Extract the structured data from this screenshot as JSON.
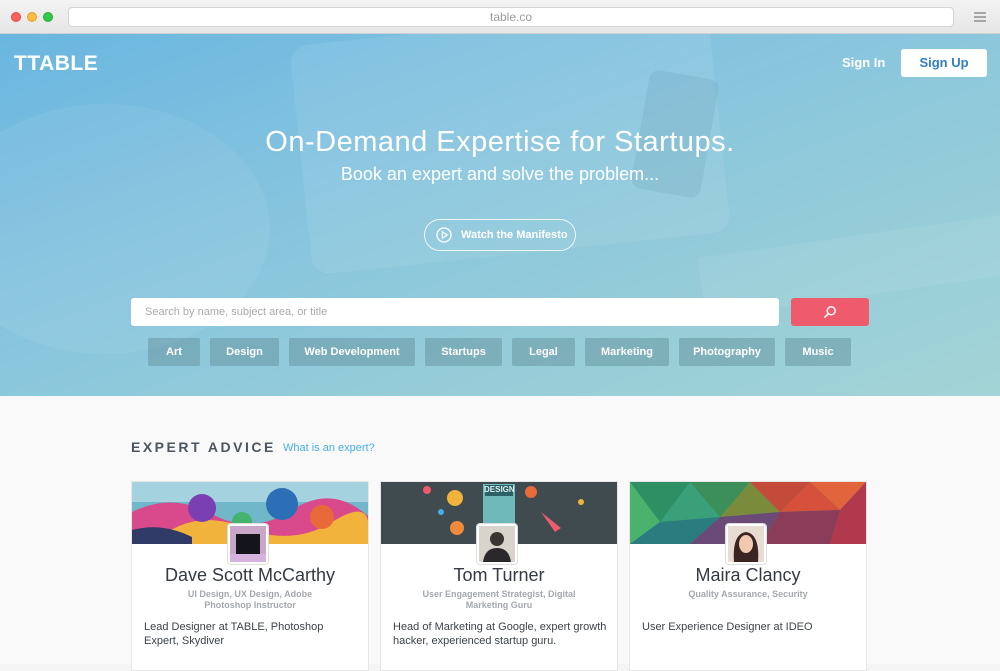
{
  "browser": {
    "url": "table.co",
    "menu_icon": "hamburger-icon"
  },
  "header": {
    "logo": "TTABLE",
    "signin": "Sign In",
    "signup": "Sign Up"
  },
  "hero": {
    "title": "On-Demand Expertise for Startups.",
    "subtitle": "Book an expert and solve the problem...",
    "manifesto_label": "Watch the Manifesto",
    "search_placeholder": "Search by name, subject area, or title",
    "tags": [
      "Art",
      "Design",
      "Web Development",
      "Startups",
      "Legal",
      "Marketing",
      "Photography",
      "Music"
    ]
  },
  "colors": {
    "accent": "#ef5b6d",
    "link": "#4aaee5",
    "signup_text": "#2f7fc1"
  },
  "expert_section": {
    "title": "EXPERT ADVICE",
    "link": "What is an expert?",
    "cards": [
      {
        "name": "Dave Scott McCarthy",
        "skills": "UI Design, UX Design, Adobe Photoshop Instructor",
        "bio": "Lead Designer at TABLE, Photoshop Expert, Skydiver"
      },
      {
        "name": "Tom Turner",
        "skills": "User Engagement Strategist, Digital Marketing Guru",
        "bio": "Head of Marketing at Google, expert growth hacker, experienced startup guru.",
        "cover_label": "DESIGN"
      },
      {
        "name": "Maira Clancy",
        "skills": "Quality Assurance, Security",
        "bio": "User Experience Designer at IDEO"
      }
    ]
  }
}
